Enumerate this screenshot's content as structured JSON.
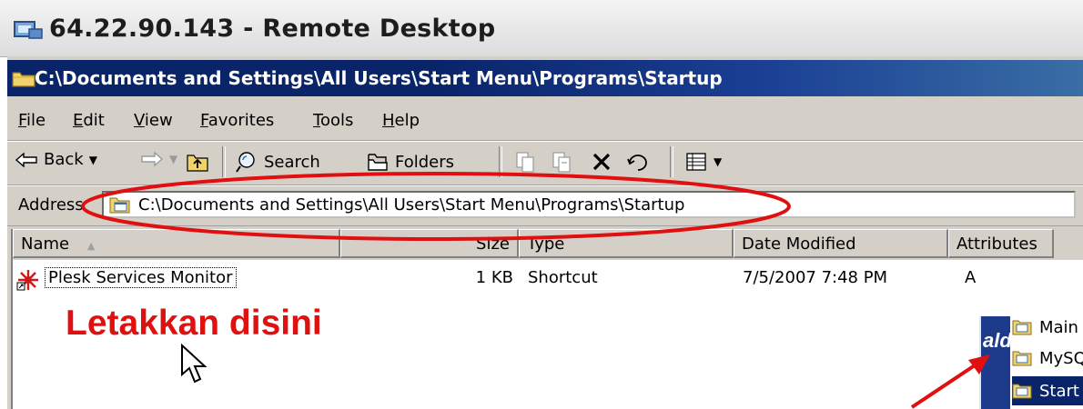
{
  "remote_desktop": {
    "title": "64.22.90.143 - Remote Desktop"
  },
  "explorer": {
    "title": "C:\\Documents and Settings\\All Users\\Start Menu\\Programs\\Startup",
    "menu": [
      "File",
      "Edit",
      "View",
      "Favorites",
      "Tools",
      "Help"
    ],
    "toolbar": {
      "back_label": "Back",
      "search_label": "Search",
      "folders_label": "Folders"
    },
    "address": {
      "label": "Address",
      "value": "C:\\Documents and Settings\\All Users\\Start Menu\\Programs\\Startup"
    },
    "columns": [
      "Name",
      "Size",
      "Type",
      "Date Modified",
      "Attributes"
    ],
    "rows": [
      {
        "name": "Plesk Services Monitor",
        "size": "1 KB",
        "type": "Shortcut",
        "date": "7/5/2007 7:48 PM",
        "attributes": "A"
      }
    ]
  },
  "annotation": {
    "text": "Letakkan disini",
    "color": "#e01010"
  },
  "inset": {
    "strip_text": "ald",
    "items": [
      "Main",
      "MySQ",
      "Start"
    ]
  },
  "colors": {
    "titlebar": "#0a246a",
    "window": "#d4d0c8",
    "annotation": "#e01010"
  }
}
